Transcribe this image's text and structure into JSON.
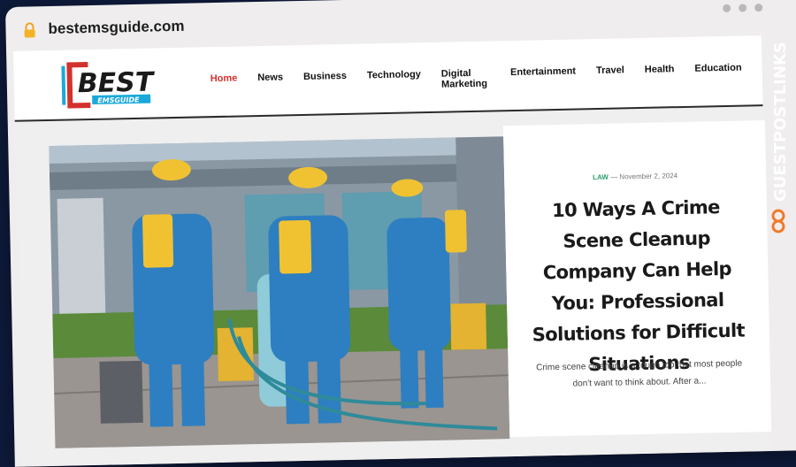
{
  "browser": {
    "url": "bestemsguide.com"
  },
  "logo": {
    "main": "BEST",
    "sub": "EMSGUIDE"
  },
  "nav": {
    "items": [
      {
        "label": "Home",
        "active": true
      },
      {
        "label": "News"
      },
      {
        "label": "Business"
      },
      {
        "label": "Technology"
      },
      {
        "label": "Digital Marketing"
      },
      {
        "label": "Entertainment"
      },
      {
        "label": "Travel"
      },
      {
        "label": "Health"
      },
      {
        "label": "Education"
      }
    ]
  },
  "article": {
    "category": "LAW",
    "separator": "—",
    "date": "November 2, 2024",
    "title": "10 Ways A Crime Scene Cleanup Company Can Help You: Professional Solutions for Difficult Situations",
    "excerpt": "Crime scene cleanup is a tough job that most people don't want to think about. After a..."
  },
  "side_brand": {
    "text": "GUESTPOSTLINKS"
  },
  "colors": {
    "accent_red": "#d2322d",
    "category_green": "#2e9d6a",
    "side_brand_orange": "#f07b2a"
  }
}
